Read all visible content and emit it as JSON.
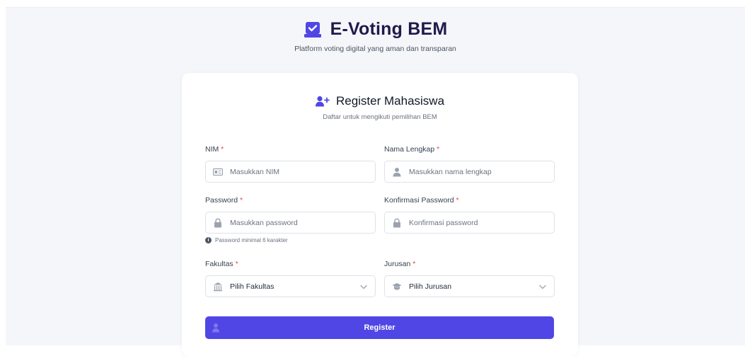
{
  "brand": {
    "title": "E-Voting BEM",
    "subtitle": "Platform voting digital yang aman dan transparan",
    "icon": "vote-box-icon"
  },
  "form": {
    "title": "Register Mahasiswa",
    "subtitle": "Daftar untuk mengikuti pemilihan BEM",
    "header_icon": "user-plus-icon",
    "required_mark": "*",
    "fields": {
      "nim": {
        "label": "NIM",
        "placeholder": "Masukkan NIM",
        "icon": "id-card-icon"
      },
      "nama": {
        "label": "Nama Lengkap",
        "placeholder": "Masukkan nama lengkap",
        "icon": "user-icon"
      },
      "password": {
        "label": "Password",
        "placeholder": "Masukkan password",
        "icon": "lock-icon",
        "hint": "Password minimal 6 karakter",
        "hint_icon": "info-icon"
      },
      "konfirmasi": {
        "label": "Konfirmasi Password",
        "placeholder": "Konfirmasi password",
        "icon": "lock-icon"
      },
      "fakultas": {
        "label": "Fakultas",
        "selected": "Pilih Fakultas",
        "icon": "university-icon"
      },
      "jurusan": {
        "label": "Jurusan",
        "selected": "Pilih Jurusan",
        "icon": "graduation-cap-icon"
      }
    },
    "submit_label": "Register",
    "submit_icon": "user-plus-icon"
  },
  "colors": {
    "accent": "#5046e5",
    "required": "#ef4444",
    "background": "#f5f6fa",
    "brand_text": "#1e1b4b"
  }
}
